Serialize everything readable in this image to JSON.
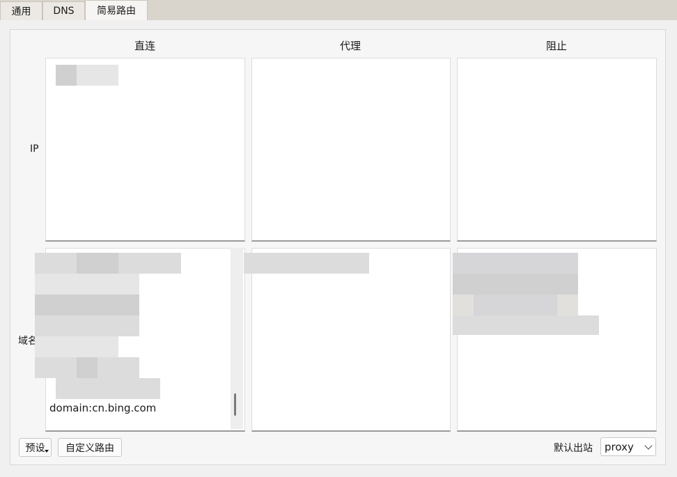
{
  "tabs": [
    {
      "label": "通用",
      "active": false
    },
    {
      "label": "DNS",
      "active": false
    },
    {
      "label": "简易路由",
      "active": true
    }
  ],
  "columns": [
    "直连",
    "代理",
    "阻止"
  ],
  "rows": [
    "IP",
    "域名"
  ],
  "domain_direct_visible_entry": "domain:cn.bing.com",
  "buttons": {
    "preset": "预设",
    "custom_routing": "自定义路由"
  },
  "default_outbound": {
    "label": "默认出站",
    "selected": "proxy"
  }
}
